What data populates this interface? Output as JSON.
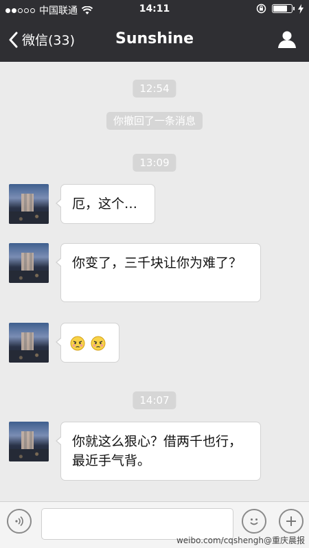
{
  "status_bar": {
    "carrier": "中国联通",
    "time": "14:11"
  },
  "nav": {
    "back_label": "微信(33)",
    "title": "Sunshine"
  },
  "messages": {
    "timestamps": [
      "12:54",
      "13:09",
      "14:07"
    ],
    "system_notice": "你撤回了一条消息",
    "bubbles": [
      "厄，这个…",
      "你变了，三千块让你为难了？",
      "",
      "你就这么狠心？借两千也行，最近手气背。"
    ],
    "emoji_count": 2,
    "emoji_icon": "embarrassed-face-icon"
  },
  "input_bar": {
    "placeholder": "",
    "voice_icon": "voice-icon",
    "emoji_icon": "smiley-icon",
    "add_icon": "plus-icon"
  },
  "watermark": "weibo.com/cqshengh@重庆晨报"
}
